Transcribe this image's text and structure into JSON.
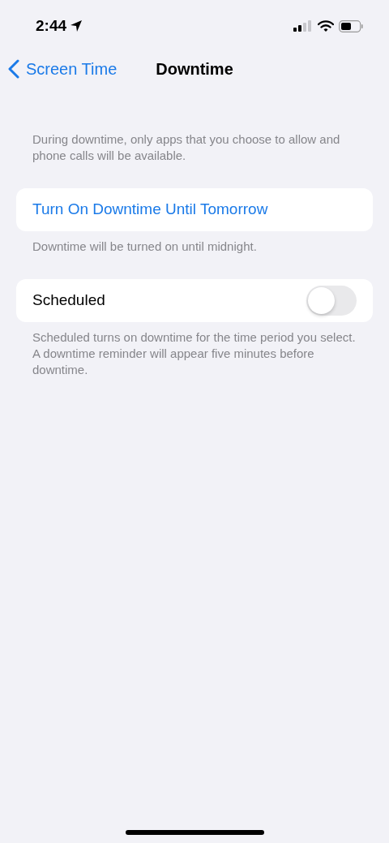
{
  "status_bar": {
    "time": "2:44"
  },
  "nav": {
    "back": "Screen Time",
    "title": "Downtime"
  },
  "intro": "During downtime, only apps that you choose to allow and phone calls will be available.",
  "sections": [
    {
      "kind": "action",
      "label": "Turn On Downtime Until Tomorrow",
      "footer": "Downtime will be turned on until midnight."
    },
    {
      "kind": "toggle",
      "label": "Scheduled",
      "on": false,
      "footer": "Scheduled turns on downtime for the time period you select. A downtime reminder will appear five minutes before downtime."
    }
  ]
}
